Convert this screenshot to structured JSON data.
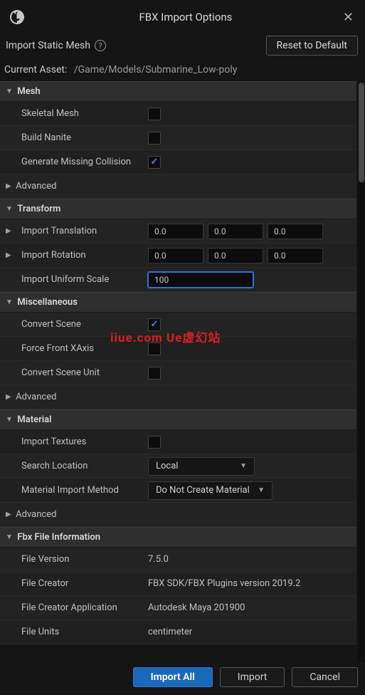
{
  "window": {
    "title": "FBX Import Options"
  },
  "header": {
    "subtitle": "Import Static Mesh",
    "reset_btn": "Reset to Default"
  },
  "asset": {
    "label": "Current Asset:",
    "path": "/Game/Models/Submarine_Low-poly"
  },
  "sections": {
    "mesh": {
      "title": "Mesh",
      "skeletal": "Skeletal Mesh",
      "build_nanite": "Build Nanite",
      "gen_collision": "Generate Missing Collision",
      "advanced": "Advanced"
    },
    "transform": {
      "title": "Transform",
      "translation": "Import Translation",
      "rotation": "Import Rotation",
      "uniform_scale": "Import Uniform Scale",
      "t": {
        "x": "0.0",
        "y": "0.0",
        "z": "0.0"
      },
      "r": {
        "x": "0.0",
        "y": "0.0",
        "z": "0.0"
      },
      "scale": "100"
    },
    "misc": {
      "title": "Miscellaneous",
      "convert_scene": "Convert Scene",
      "force_front_x": "Force Front XAxis",
      "convert_scene_unit": "Convert Scene Unit",
      "advanced": "Advanced"
    },
    "material": {
      "title": "Material",
      "import_tex": "Import Textures",
      "search_loc": "Search Location",
      "search_loc_val": "Local",
      "import_method": "Material Import Method",
      "import_method_val": "Do Not Create Material",
      "advanced": "Advanced"
    },
    "fbxinfo": {
      "title": "Fbx File Information",
      "file_version": "File Version",
      "file_version_val": "7.5.0",
      "file_creator": "File Creator",
      "file_creator_val": "FBX SDK/FBX Plugins version 2019.2",
      "file_creator_app": "File Creator Application",
      "file_creator_app_val": "Autodesk Maya 201900",
      "file_units": "File Units",
      "file_units_val": "centimeter"
    }
  },
  "buttons": {
    "import_all": "Import All",
    "import": "Import",
    "cancel": "Cancel"
  },
  "watermark": "iiue.com  Ue虚幻站"
}
